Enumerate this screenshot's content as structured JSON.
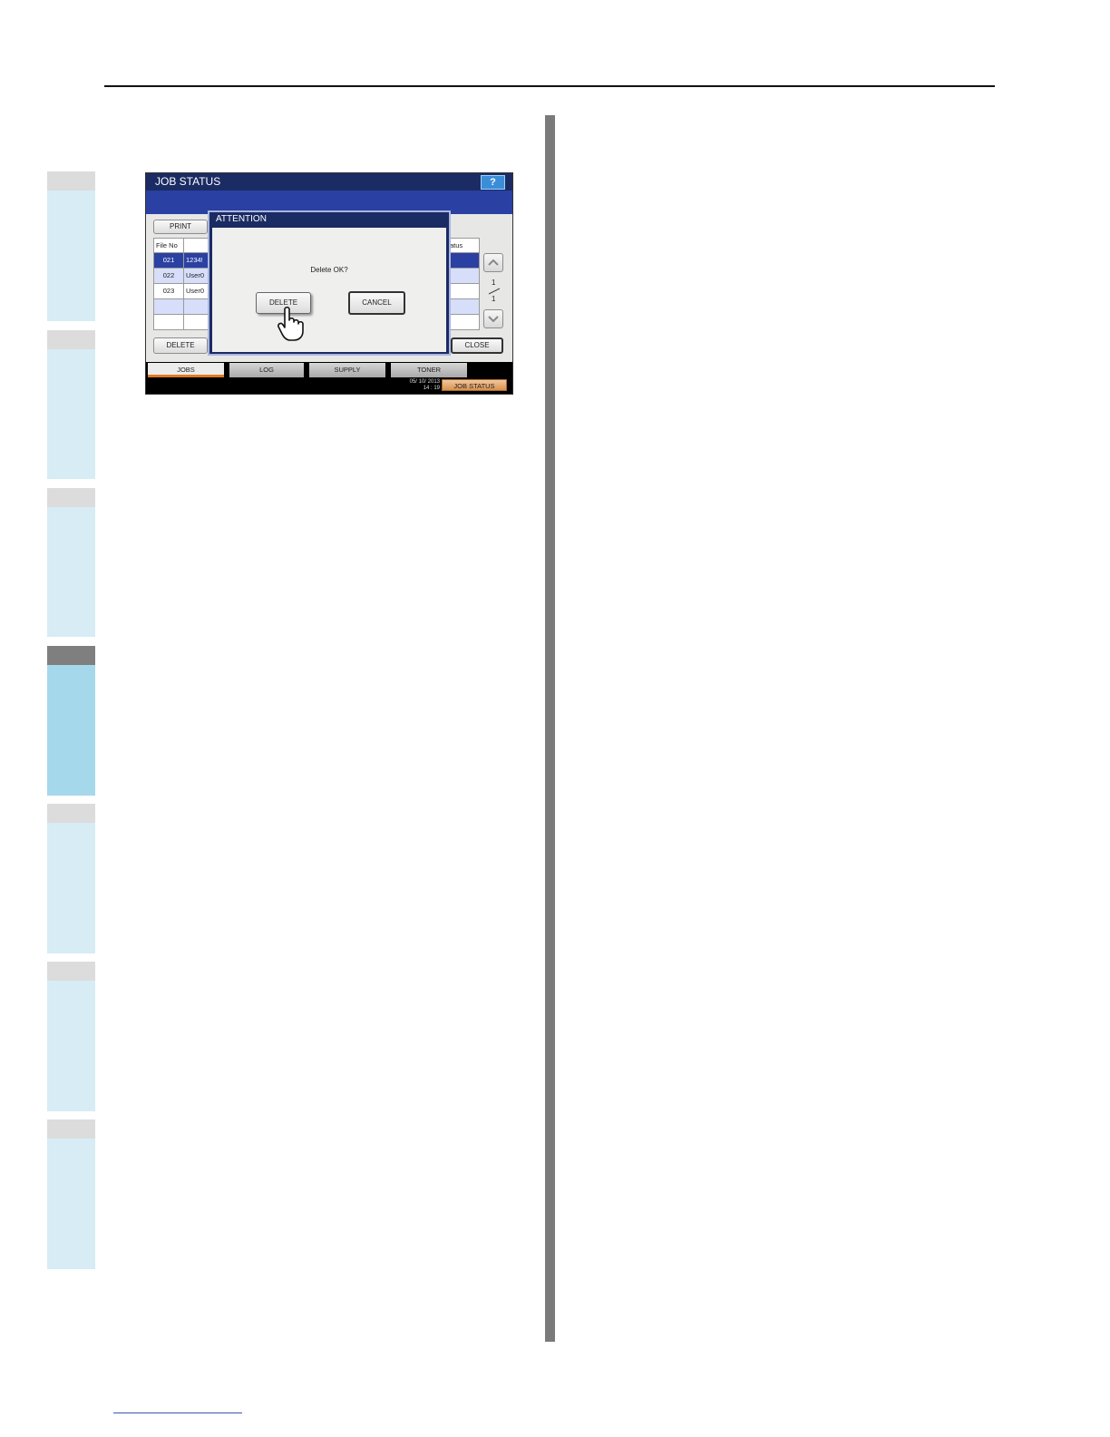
{
  "panel": {
    "title": "JOB STATUS",
    "help_label": "?",
    "print_label": "PRINT",
    "col_file_no": "File No",
    "col_status": "atus",
    "rows": [
      {
        "file_no": "021",
        "name": "1234!"
      },
      {
        "file_no": "022",
        "name": "User0"
      },
      {
        "file_no": "023",
        "name": "User0"
      },
      {
        "file_no": "",
        "name": ""
      },
      {
        "file_no": "",
        "name": ""
      }
    ],
    "page_current": "1",
    "page_total": "1",
    "delete_label": "DELETE",
    "close_label": "CLOSE",
    "tabs": [
      "JOBS",
      "LOG",
      "SUPPLY",
      "TONER"
    ],
    "date": "05/ 10/ 2013",
    "time": "14 : 19",
    "job_status_label": "JOB STATUS"
  },
  "dialog": {
    "title": "ATTENTION",
    "message": "Delete OK?",
    "delete_label": "DELETE",
    "cancel_label": "CANCEL"
  },
  "colors": {
    "title_bar": "#1b2b63",
    "accent_blue": "#2a40a2",
    "tab_active_underline": "#e07a1f",
    "chapter_tab": "#d7ecf5",
    "chapter_tab_active": "#a6d8eb"
  }
}
